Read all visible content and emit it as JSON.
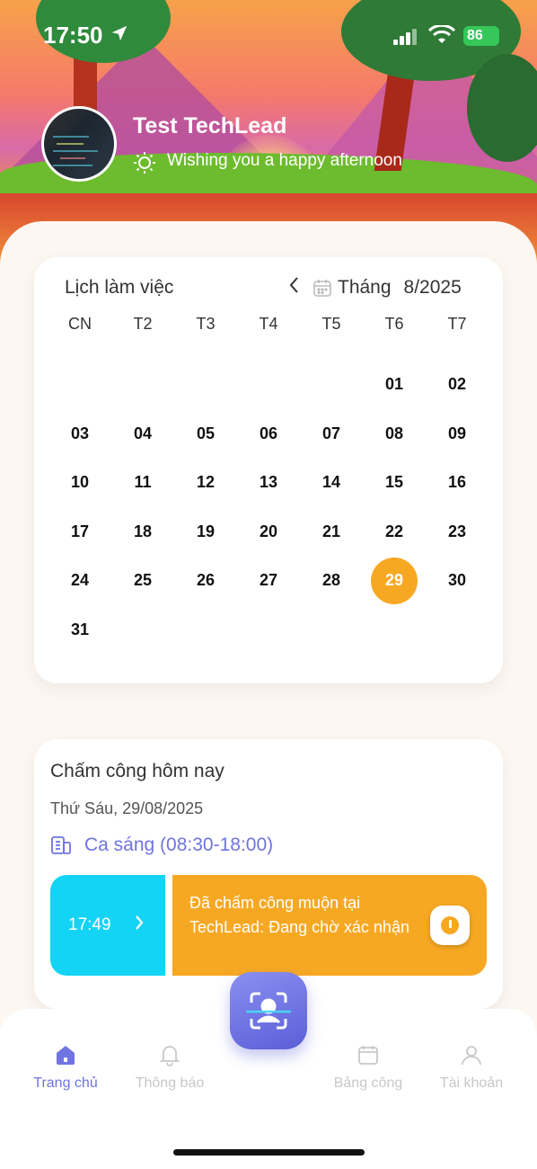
{
  "status_bar": {
    "time": "17:50",
    "battery": "86"
  },
  "profile": {
    "name": "Test TechLead",
    "greeting": "Wishing you a happy afternoon"
  },
  "calendar": {
    "title": "Lịch làm việc",
    "month_label": "Tháng",
    "month_value": "8/2025",
    "weekdays": [
      "CN",
      "T2",
      "T3",
      "T4",
      "T5",
      "T6",
      "T7"
    ],
    "weeks": [
      [
        "",
        "",
        "",
        "",
        "",
        "01",
        "02"
      ],
      [
        "03",
        "04",
        "05",
        "06",
        "07",
        "08",
        "09"
      ],
      [
        "10",
        "11",
        "12",
        "13",
        "14",
        "15",
        "16"
      ],
      [
        "17",
        "18",
        "19",
        "20",
        "21",
        "22",
        "23"
      ],
      [
        "24",
        "25",
        "26",
        "27",
        "28",
        "29",
        "30"
      ],
      [
        "31",
        "",
        "",
        "",
        "",
        "",
        ""
      ]
    ],
    "today": "29",
    "today_color": "#f7a823"
  },
  "attendance": {
    "title": "Chấm công hôm nay",
    "date": "Thứ Sáu, 29/08/2025",
    "shift": "Ca sáng (08:30-18:00)",
    "check_time": "17:49",
    "message": "Đã chấm công muộn tại TechLead: Đang chờ xác nhận",
    "check_color": "#14d4f5",
    "status_color": "#f7a823"
  },
  "nav": {
    "items": [
      {
        "label": "Trang chủ",
        "icon": "home-icon"
      },
      {
        "label": "Thông báo",
        "icon": "bell-icon"
      },
      {
        "label": "Bảng công",
        "icon": "calendar-icon"
      },
      {
        "label": "Tài khoản",
        "icon": "user-icon"
      }
    ],
    "center_icon": "face-scan-icon",
    "accent": "#6f74e0"
  }
}
